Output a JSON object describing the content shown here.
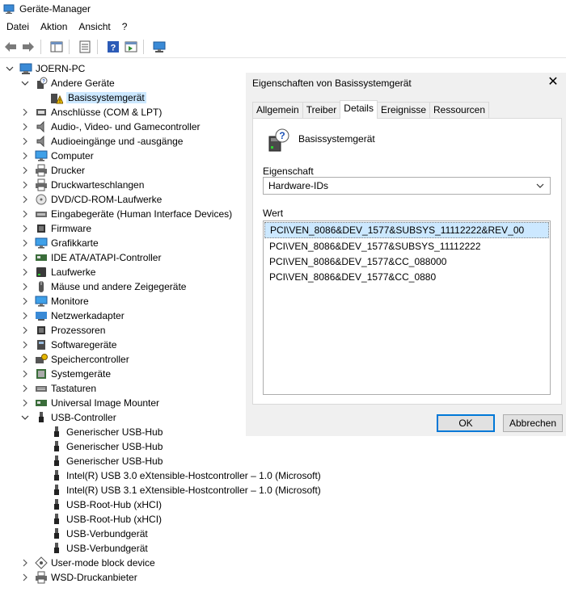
{
  "window": {
    "title": "Geräte-Manager"
  },
  "menu": [
    "Datei",
    "Aktion",
    "Ansicht",
    "?"
  ],
  "tree": [
    {
      "label": "JOERN-PC",
      "level": 0,
      "exp": "down",
      "icon": "computer-icon"
    },
    {
      "label": "Andere Geräte",
      "level": 1,
      "exp": "down",
      "icon": "unknown-device-icon"
    },
    {
      "label": "Basissystemgerät",
      "level": 2,
      "exp": "none",
      "icon": "warning-device-icon",
      "selected": true
    },
    {
      "label": "Anschlüsse (COM & LPT)",
      "level": 1,
      "exp": "right",
      "icon": "port-icon"
    },
    {
      "label": "Audio-, Video- und Gamecontroller",
      "level": 1,
      "exp": "right",
      "icon": "speaker-icon"
    },
    {
      "label": "Audioeingänge und -ausgänge",
      "level": 1,
      "exp": "right",
      "icon": "speaker-icon"
    },
    {
      "label": "Computer",
      "level": 1,
      "exp": "right",
      "icon": "monitor-icon"
    },
    {
      "label": "Drucker",
      "level": 1,
      "exp": "right",
      "icon": "printer-icon"
    },
    {
      "label": "Druckwarteschlangen",
      "level": 1,
      "exp": "right",
      "icon": "printer-icon"
    },
    {
      "label": "DVD/CD-ROM-Laufwerke",
      "level": 1,
      "exp": "right",
      "icon": "disc-icon"
    },
    {
      "label": "Eingabegeräte (Human Interface Devices)",
      "level": 1,
      "exp": "right",
      "icon": "hid-icon"
    },
    {
      "label": "Firmware",
      "level": 1,
      "exp": "right",
      "icon": "chip-icon"
    },
    {
      "label": "Grafikkarte",
      "level": 1,
      "exp": "right",
      "icon": "monitor-icon"
    },
    {
      "label": "IDE ATA/ATAPI-Controller",
      "level": 1,
      "exp": "right",
      "icon": "controller-icon"
    },
    {
      "label": "Laufwerke",
      "level": 1,
      "exp": "right",
      "icon": "drive-icon"
    },
    {
      "label": "Mäuse und andere Zeigegeräte",
      "level": 1,
      "exp": "right",
      "icon": "mouse-icon"
    },
    {
      "label": "Monitore",
      "level": 1,
      "exp": "right",
      "icon": "monitor-icon"
    },
    {
      "label": "Netzwerkadapter",
      "level": 1,
      "exp": "right",
      "icon": "network-icon"
    },
    {
      "label": "Prozessoren",
      "level": 1,
      "exp": "right",
      "icon": "chip-icon"
    },
    {
      "label": "Softwaregeräte",
      "level": 1,
      "exp": "right",
      "icon": "software-device-icon"
    },
    {
      "label": "Speichercontroller",
      "level": 1,
      "exp": "right",
      "icon": "storage-controller-icon"
    },
    {
      "label": "Systemgeräte",
      "level": 1,
      "exp": "right",
      "icon": "system-device-icon"
    },
    {
      "label": "Tastaturen",
      "level": 1,
      "exp": "right",
      "icon": "keyboard-icon"
    },
    {
      "label": "Universal Image Mounter",
      "level": 1,
      "exp": "right",
      "icon": "controller-icon"
    },
    {
      "label": "USB-Controller",
      "level": 1,
      "exp": "down",
      "icon": "usb-icon"
    },
    {
      "label": "Generischer USB-Hub",
      "level": 2,
      "exp": "none",
      "icon": "usb-icon"
    },
    {
      "label": "Generischer USB-Hub",
      "level": 2,
      "exp": "none",
      "icon": "usb-icon"
    },
    {
      "label": "Generischer USB-Hub",
      "level": 2,
      "exp": "none",
      "icon": "usb-icon"
    },
    {
      "label": "Intel(R) USB 3.0 eXtensible-Hostcontroller – 1.0 (Microsoft)",
      "level": 2,
      "exp": "none",
      "icon": "usb-icon"
    },
    {
      "label": "Intel(R) USB 3.1 eXtensible-Hostcontroller – 1.0 (Microsoft)",
      "level": 2,
      "exp": "none",
      "icon": "usb-icon"
    },
    {
      "label": "USB-Root-Hub (xHCI)",
      "level": 2,
      "exp": "none",
      "icon": "usb-icon"
    },
    {
      "label": "USB-Root-Hub (xHCI)",
      "level": 2,
      "exp": "none",
      "icon": "usb-icon"
    },
    {
      "label": "USB-Verbundgerät",
      "level": 2,
      "exp": "none",
      "icon": "usb-icon"
    },
    {
      "label": "USB-Verbundgerät",
      "level": 2,
      "exp": "none",
      "icon": "usb-icon"
    },
    {
      "label": "User-mode block device",
      "level": 1,
      "exp": "right",
      "icon": "block-device-icon"
    },
    {
      "label": "WSD-Druckanbieter",
      "level": 1,
      "exp": "right",
      "icon": "printer-icon"
    }
  ],
  "dialog": {
    "title": "Eigenschaften von Basissystemgerät",
    "tabs": [
      "Allgemein",
      "Treiber",
      "Details",
      "Ereignisse",
      "Ressourcen"
    ],
    "active_tab": "Details",
    "device_name": "Basissystemgerät",
    "property_label": "Eigenschaft",
    "property_value": "Hardware-IDs",
    "value_label": "Wert",
    "values": [
      "PCI\\VEN_8086&DEV_1577&SUBSYS_11112222&REV_00",
      "PCI\\VEN_8086&DEV_1577&SUBSYS_11112222",
      "PCI\\VEN_8086&DEV_1577&CC_088000",
      "PCI\\VEN_8086&DEV_1577&CC_0880"
    ],
    "ok_label": "OK",
    "cancel_label": "Abbrechen"
  }
}
